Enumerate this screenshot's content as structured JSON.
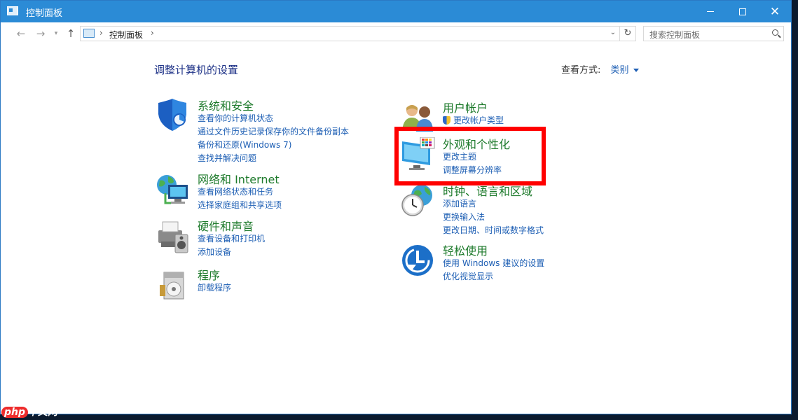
{
  "window": {
    "title": "控制面板"
  },
  "address": {
    "crumb": "控制面板",
    "search_placeholder": "搜索控制面板"
  },
  "page": {
    "title": "调整计算机的设置",
    "viewby_label": "查看方式:",
    "viewby_value": "类别"
  },
  "categories": [
    {
      "title": "系统和安全",
      "links": [
        "查看你的计算机状态",
        "通过文件历史记录保存你的文件备份副本",
        "备份和还原(Windows 7)",
        "查找并解决问题"
      ]
    },
    {
      "title": "网络和 Internet",
      "links": [
        "查看网络状态和任务",
        "选择家庭组和共享选项"
      ]
    },
    {
      "title": "硬件和声音",
      "links": [
        "查看设备和打印机",
        "添加设备"
      ]
    },
    {
      "title": "程序",
      "links": [
        "卸载程序"
      ]
    },
    {
      "title": "用户帐户",
      "links": [
        "更改帐户类型"
      ]
    },
    {
      "title": "外观和个性化",
      "links": [
        "更改主题",
        "调整屏幕分辨率"
      ]
    },
    {
      "title": "时钟、语言和区域",
      "links": [
        "添加语言",
        "更换输入法",
        "更改日期、时间或数字格式"
      ]
    },
    {
      "title": "轻松使用",
      "links": [
        "使用 Windows 建议的设置",
        "优化视觉显示"
      ]
    }
  ],
  "watermark": {
    "php": "php",
    "site": "中文网"
  }
}
